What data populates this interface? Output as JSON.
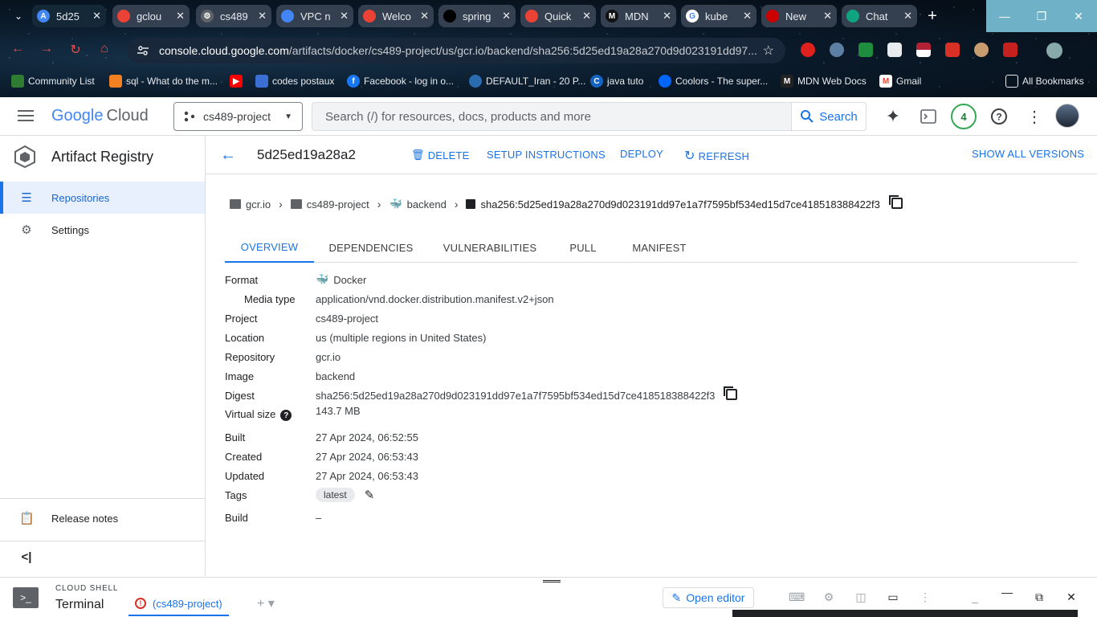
{
  "browser": {
    "tabs": [
      {
        "label": "5d25",
        "favicon": "artifact-registry",
        "color": "#4285f4"
      },
      {
        "label": "gclou",
        "favicon": "google-cloud",
        "color": "#ea4335"
      },
      {
        "label": "cs489",
        "favicon": "gear",
        "color": "#5f6368"
      },
      {
        "label": "VPC n",
        "favicon": "vpc",
        "color": "#4285f4"
      },
      {
        "label": "Welco",
        "favicon": "google-cloud",
        "color": "#ea4335"
      },
      {
        "label": "spring",
        "favicon": "github",
        "color": "#000000"
      },
      {
        "label": "Quick",
        "favicon": "google-cloud",
        "color": "#ea4335"
      },
      {
        "label": "MDN",
        "favicon": "mdn",
        "color": "#000000"
      },
      {
        "label": "kube",
        "favicon": "google",
        "color": "#4285f4"
      },
      {
        "label": "New",
        "favicon": "redhat",
        "color": "#cc0000"
      },
      {
        "label": "Chat",
        "favicon": "chatgpt",
        "color": "#10a37f"
      }
    ],
    "url_host": "console.cloud.google.com",
    "url_path": "/artifacts/docker/cs489-project/us/gcr.io/backend/sha256:5d25ed19a28a270d9d023191dd97...",
    "bookmarks": [
      {
        "label": "Community List"
      },
      {
        "label": "sql - What do the m..."
      },
      {
        "label": ""
      },
      {
        "label": "codes postaux"
      },
      {
        "label": "Facebook - log in o..."
      },
      {
        "label": "DEFAULT_Iran - 20 P..."
      },
      {
        "label": "java tuto"
      },
      {
        "label": "Coolors - The super..."
      },
      {
        "label": "MDN Web Docs"
      },
      {
        "label": "Gmail"
      }
    ],
    "all_bookmarks": "All Bookmarks"
  },
  "header": {
    "logo_google": "Google",
    "logo_cloud": "Cloud",
    "project": "cs489-project",
    "search_placeholder": "Search (/) for resources, docs, products and more",
    "search_button": "Search",
    "notifications": "4"
  },
  "sidebar": {
    "title": "Artifact Registry",
    "items": [
      {
        "label": "Repositories",
        "icon": "list-icon",
        "selected": true
      },
      {
        "label": "Settings",
        "icon": "gear-icon",
        "selected": false
      }
    ],
    "release_notes": "Release notes",
    "collapse": "<|"
  },
  "action_bar": {
    "title": "5d25ed19a28a2",
    "delete": "DELETE",
    "setup": "SETUP INSTRUCTIONS",
    "deploy": "DEPLOY",
    "refresh": "REFRESH",
    "show_all": "SHOW ALL VERSIONS"
  },
  "breadcrumbs": [
    "gcr.io",
    "cs489-project",
    "backend",
    "sha256:5d25ed19a28a270d9d023191dd97e1a7f7595bf534ed15d7ce418518388422f3"
  ],
  "tabs": [
    "OVERVIEW",
    "DEPENDENCIES",
    "VULNERABILITIES",
    "PULL",
    "MANIFEST"
  ],
  "details": {
    "format_label": "Format",
    "format_value": "Docker",
    "media_label": "Media type",
    "media_value": "application/vnd.docker.distribution.manifest.v2+json",
    "project_label": "Project",
    "project_value": "cs489-project",
    "location_label": "Location",
    "location_value": "us (multiple regions in United States)",
    "repo_label": "Repository",
    "repo_value": "gcr.io",
    "image_label": "Image",
    "image_value": "backend",
    "digest_label": "Digest",
    "digest_value": "sha256:5d25ed19a28a270d9d023191dd97e1a7f7595bf534ed15d7ce418518388422f3",
    "size_label": "Virtual size",
    "size_value": "143.7 MB",
    "built_label": "Built",
    "built_value": "27 Apr 2024, 06:52:55",
    "created_label": "Created",
    "created_value": "27 Apr 2024, 06:53:43",
    "updated_label": "Updated",
    "updated_value": "27 Apr 2024, 06:53:43",
    "tags_label": "Tags",
    "tags_value": "latest",
    "build_label": "Build",
    "build_value": "–"
  },
  "shell": {
    "section": "CLOUD SHELL",
    "title": "Terminal",
    "tab": "(cs489-project)",
    "open_editor": "Open editor"
  },
  "colors": {
    "accent": "#1a73e8",
    "selected_bg": "#e8f0fe",
    "notification": "#34a853"
  }
}
